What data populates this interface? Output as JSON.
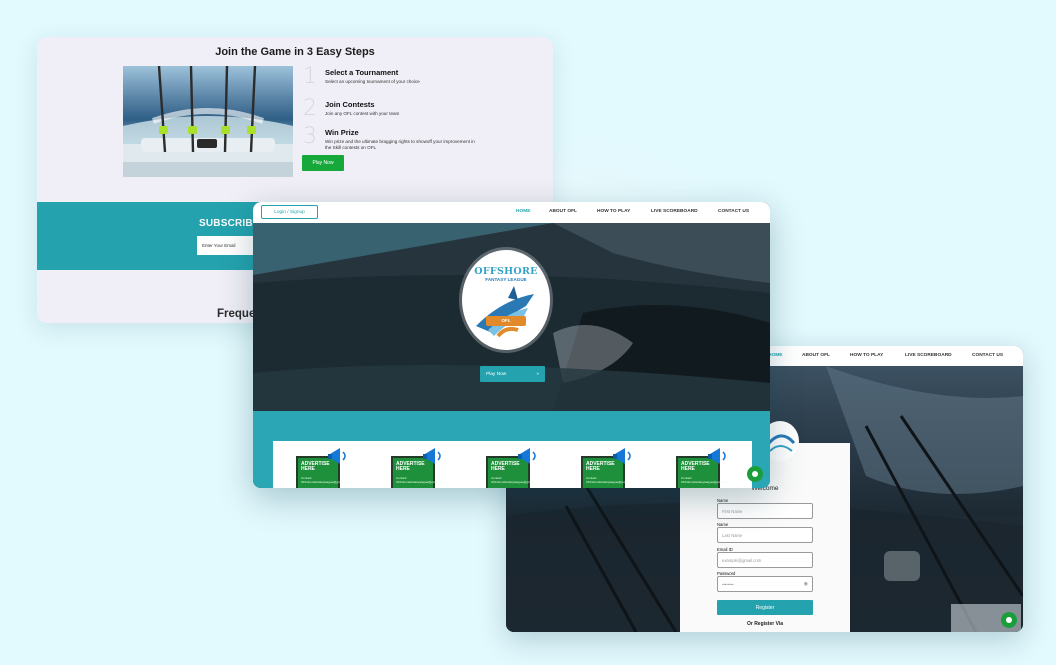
{
  "steps_page": {
    "title": "Join the Game in 3 Easy Steps",
    "steps": [
      {
        "num": "1",
        "title": "Select a Tournament",
        "desc": "Select an upcoming tournament of your choice"
      },
      {
        "num": "2",
        "title": "Join Contests",
        "desc": "Join any OFL contest with your team"
      },
      {
        "num": "3",
        "title": "Win Prize",
        "desc": "Win prize and the ultimate bragging rights to showoff your improvement in the Skill contests on OFL"
      }
    ],
    "play_button": "Play Now",
    "subscribe_heading": "SUBSCRIBE",
    "email_placeholder": "Enter Your Email",
    "faq_heading": "Freque"
  },
  "home_page": {
    "login_label": "Login / Signup",
    "nav": [
      "HOME",
      "ABOUT OFL",
      "HOW TO PLAY",
      "LIVE SCOREBOARD",
      "CONTACT US"
    ],
    "logo_title": "OFFSHORE",
    "logo_subtitle": "FANTASY LEAGUE",
    "logo_badge": "OFL",
    "play_button": "Play Now",
    "play_arrow": "»",
    "ads": [
      {
        "title": "ADVERTISE HERE",
        "contact": "Contact: OFFshorefantasyleague@gmail.com"
      },
      {
        "title": "ADVERTISE HERE",
        "contact": "Contact: OFFshorefantasyleague@gmail.com"
      },
      {
        "title": "ADVERTISE HERE",
        "contact": "Contact: OFFshorefantasyleague@gmail.com"
      },
      {
        "title": "ADVERTISE HERE",
        "contact": "Contact: OFFshorefantasyleague@gmail.com"
      },
      {
        "title": "ADVERTISE HERE",
        "contact": "Contact: OFFshorefantasyleague@gmail.com"
      }
    ]
  },
  "register_page": {
    "nav": [
      "HOME",
      "ABOUT OFL",
      "HOW TO PLAY",
      "LIVE SCOREBOARD",
      "CONTACT US"
    ],
    "welcome": "Welcome",
    "fields": [
      {
        "label": "Name",
        "placeholder": "First Name"
      },
      {
        "label": "Name",
        "placeholder": "Last Name"
      },
      {
        "label": "Email ID",
        "placeholder": "example@gmail.com"
      },
      {
        "label": "Password",
        "placeholder": "••••••••"
      }
    ],
    "register_button": "Register",
    "or_register": "Or Register Via"
  },
  "colors": {
    "background": "#e2f9fd",
    "teal": "#24a3ae",
    "green": "#16a83a"
  }
}
